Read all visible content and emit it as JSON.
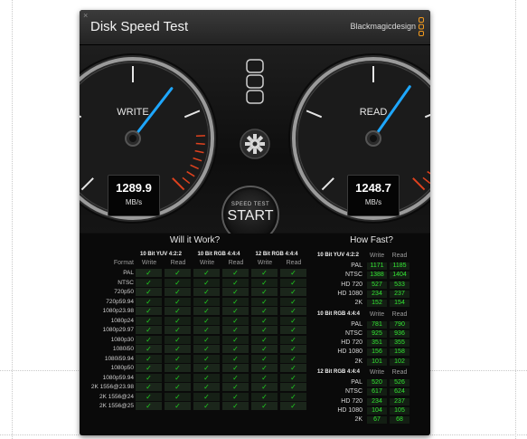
{
  "app_title": "Disk Speed Test",
  "brand": "Blackmagicdesign",
  "close_glyph": "×",
  "write_gauge": {
    "label": "WRITE",
    "value": "1289.9",
    "unit": "MB/s",
    "needle_fraction": 0.64
  },
  "read_gauge": {
    "label": "READ",
    "value": "1248.7",
    "unit": "MB/s",
    "needle_fraction": 0.63
  },
  "start_button": {
    "sub_label": "SPEED TEST",
    "label": "START"
  },
  "settings_icon": "gear-icon",
  "target_icon": "target-select-icon",
  "colors": {
    "check_green": "#1fd21f",
    "high_value_green": "#33e533",
    "needle_blue": "#1ea7ff",
    "redline": "#e0421e",
    "window_bg": "#101010"
  },
  "will_it_work": {
    "heading": "Will it Work?",
    "format_header": "Format",
    "groups": [
      {
        "name": "10 Bit YUV 4:2:2",
        "write": "Write",
        "read": "Read"
      },
      {
        "name": "10 Bit RGB 4:4:4",
        "write": "Write",
        "read": "Read"
      },
      {
        "name": "12 Bit RGB 4:4:4",
        "write": "Write",
        "read": "Read"
      }
    ],
    "check_glyph": "✓",
    "rows": [
      {
        "format": "PAL",
        "checks": [
          true,
          true,
          true,
          true,
          true,
          true
        ]
      },
      {
        "format": "NTSC",
        "checks": [
          true,
          true,
          true,
          true,
          true,
          true
        ]
      },
      {
        "format": "720p50",
        "checks": [
          true,
          true,
          true,
          true,
          true,
          true
        ]
      },
      {
        "format": "720p59.94",
        "checks": [
          true,
          true,
          true,
          true,
          true,
          true
        ]
      },
      {
        "format": "1080p23.98",
        "checks": [
          true,
          true,
          true,
          true,
          true,
          true
        ]
      },
      {
        "format": "1080p24",
        "checks": [
          true,
          true,
          true,
          true,
          true,
          true
        ]
      },
      {
        "format": "1080p29.97",
        "checks": [
          true,
          true,
          true,
          true,
          true,
          true
        ]
      },
      {
        "format": "1080p30",
        "checks": [
          true,
          true,
          true,
          true,
          true,
          true
        ]
      },
      {
        "format": "1080i50",
        "checks": [
          true,
          true,
          true,
          true,
          true,
          true
        ]
      },
      {
        "format": "1080i59.94",
        "checks": [
          true,
          true,
          true,
          true,
          true,
          true
        ]
      },
      {
        "format": "1080p50",
        "checks": [
          true,
          true,
          true,
          true,
          true,
          true
        ]
      },
      {
        "format": "1080p59.94",
        "checks": [
          true,
          true,
          true,
          true,
          true,
          true
        ]
      },
      {
        "format": "2K 1556@23.98",
        "checks": [
          true,
          true,
          true,
          true,
          true,
          true
        ]
      },
      {
        "format": "2K 1556@24",
        "checks": [
          true,
          true,
          true,
          true,
          true,
          true
        ]
      },
      {
        "format": "2K 1556@25",
        "checks": [
          true,
          true,
          true,
          true,
          true,
          true
        ]
      }
    ]
  },
  "how_fast": {
    "heading": "How Fast?",
    "sections": [
      {
        "name": "10 Bit YUV 4:2:2",
        "write": "Write",
        "read": "Read",
        "rows": [
          {
            "format": "PAL",
            "write": "1171",
            "read": "1185"
          },
          {
            "format": "NTSC",
            "write": "1388",
            "read": "1404"
          },
          {
            "format": "HD 720",
            "write": "527",
            "read": "533"
          },
          {
            "format": "HD 1080",
            "write": "234",
            "read": "237"
          },
          {
            "format": "2K",
            "write": "152",
            "read": "154"
          }
        ]
      },
      {
        "name": "10 Bit RGB 4:4:4",
        "write": "Write",
        "read": "Read",
        "rows": [
          {
            "format": "PAL",
            "write": "781",
            "read": "790"
          },
          {
            "format": "NTSC",
            "write": "925",
            "read": "936"
          },
          {
            "format": "HD 720",
            "write": "351",
            "read": "355"
          },
          {
            "format": "HD 1080",
            "write": "156",
            "read": "158"
          },
          {
            "format": "2K",
            "write": "101",
            "read": "102"
          }
        ]
      },
      {
        "name": "12 Bit RGB 4:4:4",
        "write": "Write",
        "read": "Read",
        "rows": [
          {
            "format": "PAL",
            "write": "520",
            "read": "526"
          },
          {
            "format": "NTSC",
            "write": "617",
            "read": "624"
          },
          {
            "format": "HD 720",
            "write": "234",
            "read": "237"
          },
          {
            "format": "HD 1080",
            "write": "104",
            "read": "105"
          },
          {
            "format": "2K",
            "write": "67",
            "read": "68"
          }
        ]
      }
    ]
  }
}
